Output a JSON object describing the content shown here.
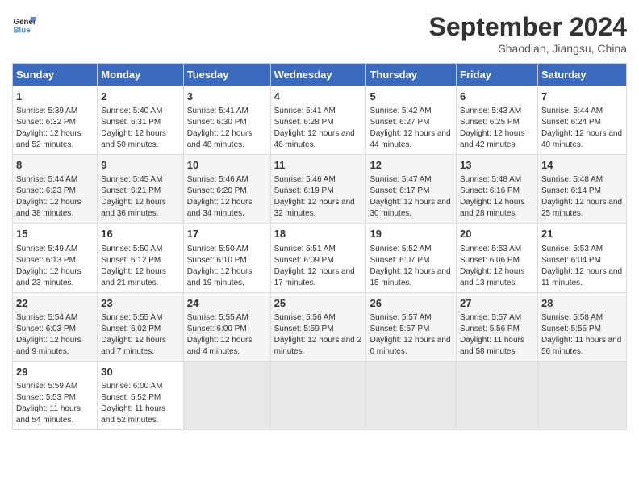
{
  "header": {
    "logo_line1": "General",
    "logo_line2": "Blue",
    "month": "September 2024",
    "location": "Shaodian, Jiangsu, China"
  },
  "days_of_week": [
    "Sunday",
    "Monday",
    "Tuesday",
    "Wednesday",
    "Thursday",
    "Friday",
    "Saturday"
  ],
  "weeks": [
    [
      {
        "day": "1",
        "sunrise": "5:39 AM",
        "sunset": "6:32 PM",
        "daylight": "12 hours and 52 minutes."
      },
      {
        "day": "2",
        "sunrise": "5:40 AM",
        "sunset": "6:31 PM",
        "daylight": "12 hours and 50 minutes."
      },
      {
        "day": "3",
        "sunrise": "5:41 AM",
        "sunset": "6:30 PM",
        "daylight": "12 hours and 48 minutes."
      },
      {
        "day": "4",
        "sunrise": "5:41 AM",
        "sunset": "6:28 PM",
        "daylight": "12 hours and 46 minutes."
      },
      {
        "day": "5",
        "sunrise": "5:42 AM",
        "sunset": "6:27 PM",
        "daylight": "12 hours and 44 minutes."
      },
      {
        "day": "6",
        "sunrise": "5:43 AM",
        "sunset": "6:25 PM",
        "daylight": "12 hours and 42 minutes."
      },
      {
        "day": "7",
        "sunrise": "5:44 AM",
        "sunset": "6:24 PM",
        "daylight": "12 hours and 40 minutes."
      }
    ],
    [
      {
        "day": "8",
        "sunrise": "5:44 AM",
        "sunset": "6:23 PM",
        "daylight": "12 hours and 38 minutes."
      },
      {
        "day": "9",
        "sunrise": "5:45 AM",
        "sunset": "6:21 PM",
        "daylight": "12 hours and 36 minutes."
      },
      {
        "day": "10",
        "sunrise": "5:46 AM",
        "sunset": "6:20 PM",
        "daylight": "12 hours and 34 minutes."
      },
      {
        "day": "11",
        "sunrise": "5:46 AM",
        "sunset": "6:19 PM",
        "daylight": "12 hours and 32 minutes."
      },
      {
        "day": "12",
        "sunrise": "5:47 AM",
        "sunset": "6:17 PM",
        "daylight": "12 hours and 30 minutes."
      },
      {
        "day": "13",
        "sunrise": "5:48 AM",
        "sunset": "6:16 PM",
        "daylight": "12 hours and 28 minutes."
      },
      {
        "day": "14",
        "sunrise": "5:48 AM",
        "sunset": "6:14 PM",
        "daylight": "12 hours and 25 minutes."
      }
    ],
    [
      {
        "day": "15",
        "sunrise": "5:49 AM",
        "sunset": "6:13 PM",
        "daylight": "12 hours and 23 minutes."
      },
      {
        "day": "16",
        "sunrise": "5:50 AM",
        "sunset": "6:12 PM",
        "daylight": "12 hours and 21 minutes."
      },
      {
        "day": "17",
        "sunrise": "5:50 AM",
        "sunset": "6:10 PM",
        "daylight": "12 hours and 19 minutes."
      },
      {
        "day": "18",
        "sunrise": "5:51 AM",
        "sunset": "6:09 PM",
        "daylight": "12 hours and 17 minutes."
      },
      {
        "day": "19",
        "sunrise": "5:52 AM",
        "sunset": "6:07 PM",
        "daylight": "12 hours and 15 minutes."
      },
      {
        "day": "20",
        "sunrise": "5:53 AM",
        "sunset": "6:06 PM",
        "daylight": "12 hours and 13 minutes."
      },
      {
        "day": "21",
        "sunrise": "5:53 AM",
        "sunset": "6:04 PM",
        "daylight": "12 hours and 11 minutes."
      }
    ],
    [
      {
        "day": "22",
        "sunrise": "5:54 AM",
        "sunset": "6:03 PM",
        "daylight": "12 hours and 9 minutes."
      },
      {
        "day": "23",
        "sunrise": "5:55 AM",
        "sunset": "6:02 PM",
        "daylight": "12 hours and 7 minutes."
      },
      {
        "day": "24",
        "sunrise": "5:55 AM",
        "sunset": "6:00 PM",
        "daylight": "12 hours and 4 minutes."
      },
      {
        "day": "25",
        "sunrise": "5:56 AM",
        "sunset": "5:59 PM",
        "daylight": "12 hours and 2 minutes."
      },
      {
        "day": "26",
        "sunrise": "5:57 AM",
        "sunset": "5:57 PM",
        "daylight": "12 hours and 0 minutes."
      },
      {
        "day": "27",
        "sunrise": "5:57 AM",
        "sunset": "5:56 PM",
        "daylight": "11 hours and 58 minutes."
      },
      {
        "day": "28",
        "sunrise": "5:58 AM",
        "sunset": "5:55 PM",
        "daylight": "11 hours and 56 minutes."
      }
    ],
    [
      {
        "day": "29",
        "sunrise": "5:59 AM",
        "sunset": "5:53 PM",
        "daylight": "11 hours and 54 minutes."
      },
      {
        "day": "30",
        "sunrise": "6:00 AM",
        "sunset": "5:52 PM",
        "daylight": "11 hours and 52 minutes."
      },
      null,
      null,
      null,
      null,
      null
    ]
  ]
}
